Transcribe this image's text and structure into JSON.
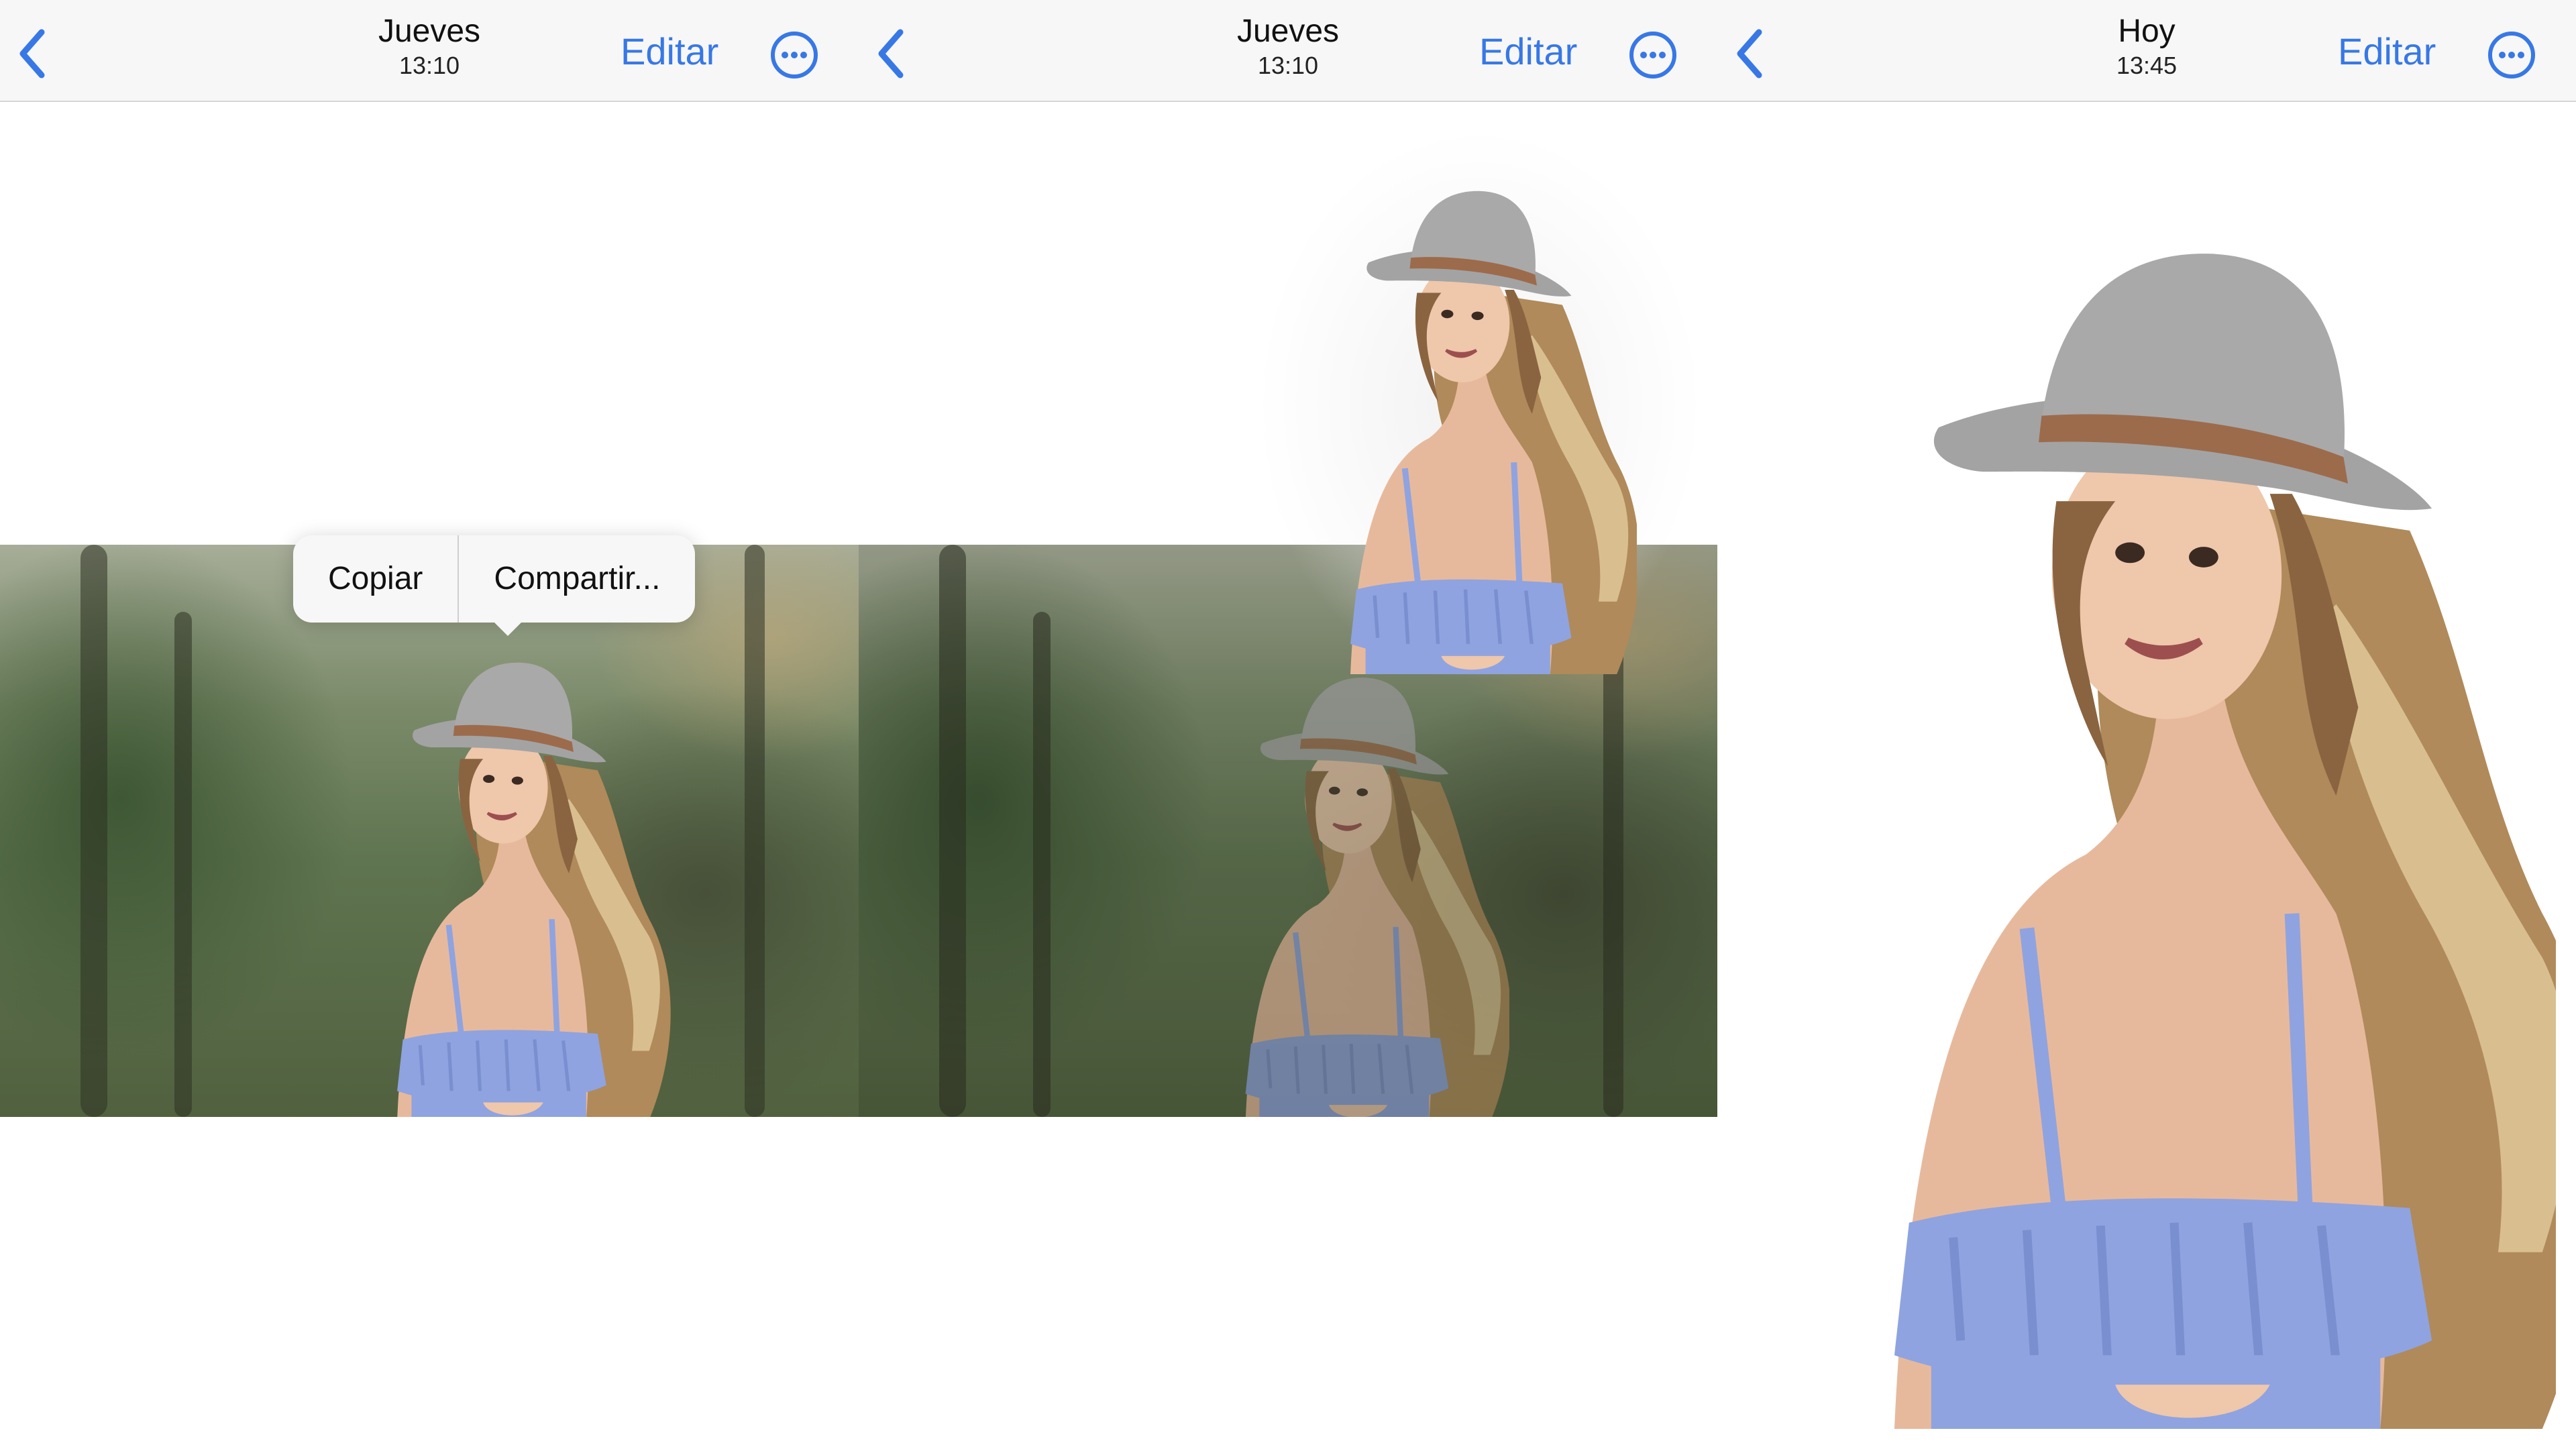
{
  "panels": [
    {
      "navbar": {
        "title": "Jueves",
        "time": "13:10",
        "edit_label": "Editar"
      },
      "context_menu": {
        "copy_label": "Copiar",
        "share_label": "Compartir..."
      }
    },
    {
      "navbar": {
        "title": "Jueves",
        "time": "13:10",
        "edit_label": "Editar"
      }
    },
    {
      "navbar": {
        "title": "Hoy",
        "time": "13:45",
        "edit_label": "Editar"
      }
    }
  ],
  "icons": {
    "back": "chevron-left-icon",
    "more": "ellipsis-circle-icon"
  },
  "colors": {
    "accent": "#3778e6",
    "navbar_bg": "#f7f7f7",
    "dress": "#8fa3e0",
    "hat": "#9a9a9a"
  }
}
